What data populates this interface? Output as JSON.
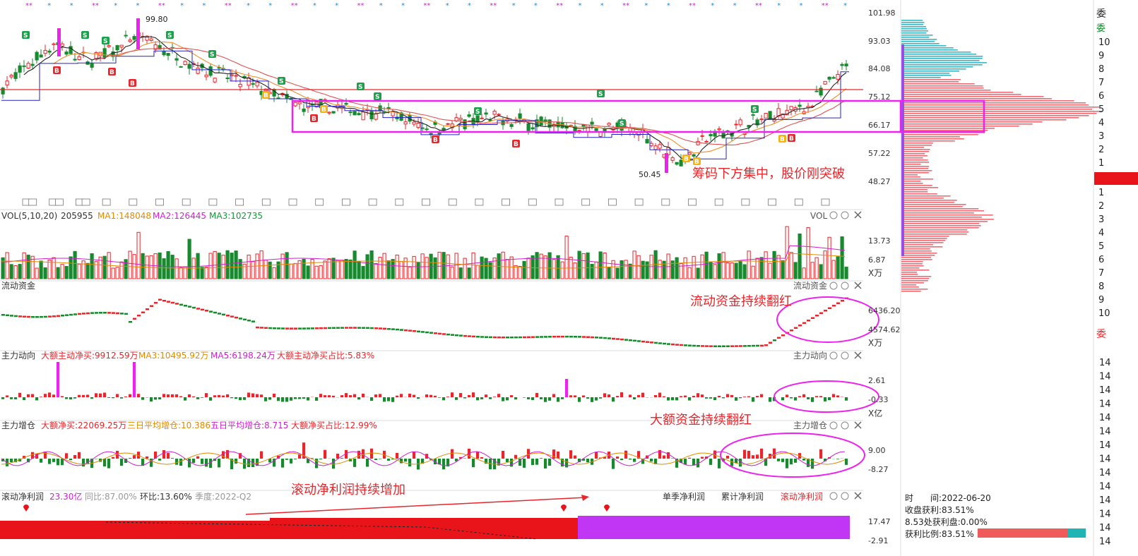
{
  "main": {
    "y_ticks": [
      "101.98",
      "93.03",
      "84.08",
      "75.12",
      "66.17",
      "57.22",
      "48.27"
    ],
    "high_label": "99.80",
    "low_label": "50.45",
    "annotation": "筹码下方集中，股价刚突破",
    "colors": {
      "up": "#e8262b",
      "down": "#19892f",
      "ma_black": "#222222",
      "ma_blue": "#2222cc",
      "box": "#ee22ee"
    }
  },
  "vol": {
    "title": "VOL(5,10,20)",
    "value": "205955",
    "ma1": "MA1:148048",
    "ma2": "MA2:126445",
    "ma3": "MA3:102735",
    "right_name": "VOL",
    "ticks": [
      "13.73",
      "6.87"
    ],
    "unit": "X万"
  },
  "flow": {
    "title": "流动资金",
    "right_name": "流动资金",
    "ticks": [
      "6436.20",
      "4574.62"
    ],
    "unit": "X万",
    "annotation": "流动资金持续翻红"
  },
  "main_force": {
    "title": "主力动向",
    "net_buy": "大额主动净买:9912.59万",
    "ma3": "MA3:10495.92万",
    "ma5": "MA5:6198.24万",
    "ratio": "大额主动净买占比:5.83%",
    "right_name": "主力动向",
    "ticks": [
      "2.61",
      "-0.33"
    ],
    "unit": "X亿",
    "annotation": "大额资金持续翻红"
  },
  "accum": {
    "title": "主力增仓",
    "net_buy": "大额净买:22069.25万",
    "avg3": "三日平均增仓:10.386",
    "avg5": "五日平均增仓:8.715",
    "ratio": "大额净买占比:12.99%",
    "right_name": "主力增仓",
    "ticks": [
      "9.00",
      "-8.27"
    ],
    "annotation": ""
  },
  "profit": {
    "title": "滚动净利润",
    "value": "23.30亿",
    "yoy": "同比:87.00%",
    "qoq": "环比:13.60%",
    "season": "季度:2022-Q2",
    "annotation": "滚动净利润持续增加",
    "tabs": [
      "单季净利润",
      "累计净利润",
      "滚动净利润"
    ],
    "ticks": [
      "17.47",
      "-2.91"
    ]
  },
  "chips": {
    "date_label": "时　　间:2022-06-20",
    "profit_label": "收盘获利:83.51%",
    "chip_label": "8.53处获利盘:0.00%",
    "ratio_label": "获利比例:83.51%"
  },
  "edge": {
    "label_top": "委",
    "label_mid": "委",
    "digits": [
      "10",
      "9",
      "8",
      "7",
      "6",
      "5",
      "4",
      "3",
      "2",
      "1",
      "1",
      "2",
      "3",
      "4",
      "5",
      "6",
      "7",
      "8",
      "9",
      "10"
    ],
    "bottom_digits": [
      "14",
      "14",
      "14",
      "14",
      "14",
      "14",
      "14",
      "14",
      "14",
      "14",
      "14",
      "14",
      "14",
      "14"
    ]
  }
}
